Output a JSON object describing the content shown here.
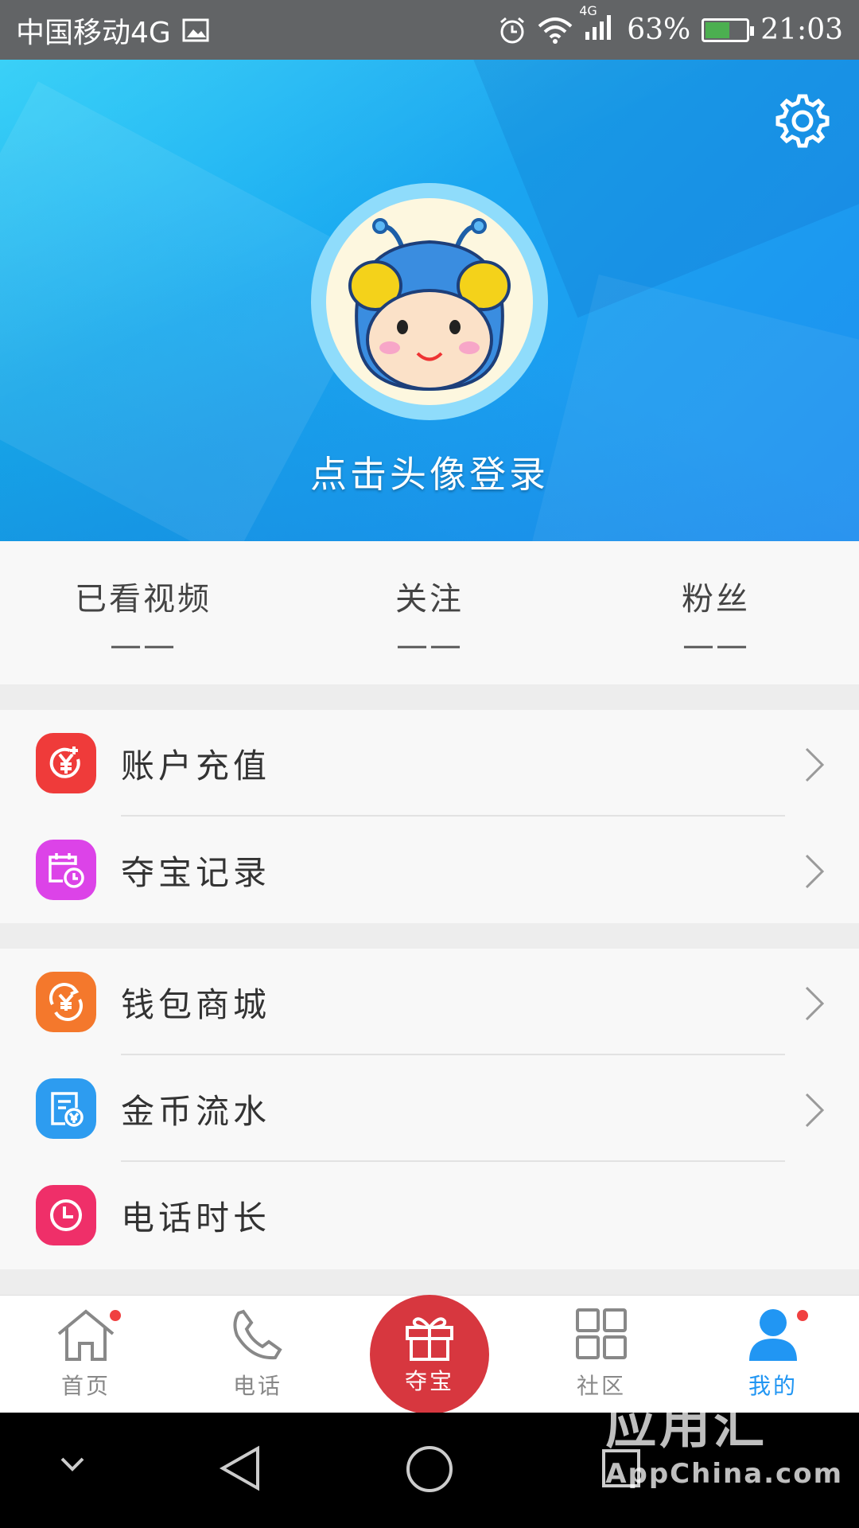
{
  "status_bar": {
    "carrier": "中国移动4G",
    "network": "4G",
    "battery": "63%",
    "battery_level": 0.63,
    "time": "21:03"
  },
  "header": {
    "login_prompt": "点击头像登录",
    "settings_icon": "gear-icon"
  },
  "stats": [
    {
      "label": "已看视频",
      "value": "——"
    },
    {
      "label": "关注",
      "value": "——"
    },
    {
      "label": "粉丝",
      "value": "——"
    }
  ],
  "menu": {
    "group1": [
      {
        "label": "账户充值",
        "icon": "recharge-icon",
        "color": "#ef3b3a"
      },
      {
        "label": "夺宝记录",
        "icon": "calendar-clock-icon",
        "color": "#dc43e8"
      }
    ],
    "group2": [
      {
        "label": "钱包商城",
        "icon": "wallet-icon",
        "color": "#f4782c"
      },
      {
        "label": "金币流水",
        "icon": "receipt-icon",
        "color": "#2d9cf0"
      },
      {
        "label": "电话时长",
        "icon": "clock-icon",
        "color": "#ef2f69"
      }
    ]
  },
  "bottom_nav": {
    "home": "首页",
    "phone": "电话",
    "treasure": "夺宝",
    "community": "社区",
    "mine": "我的",
    "active_color": "#2196f3",
    "center_color": "#d7373f"
  },
  "watermark": {
    "title": "应用汇",
    "subtitle": "AppChina.com"
  }
}
